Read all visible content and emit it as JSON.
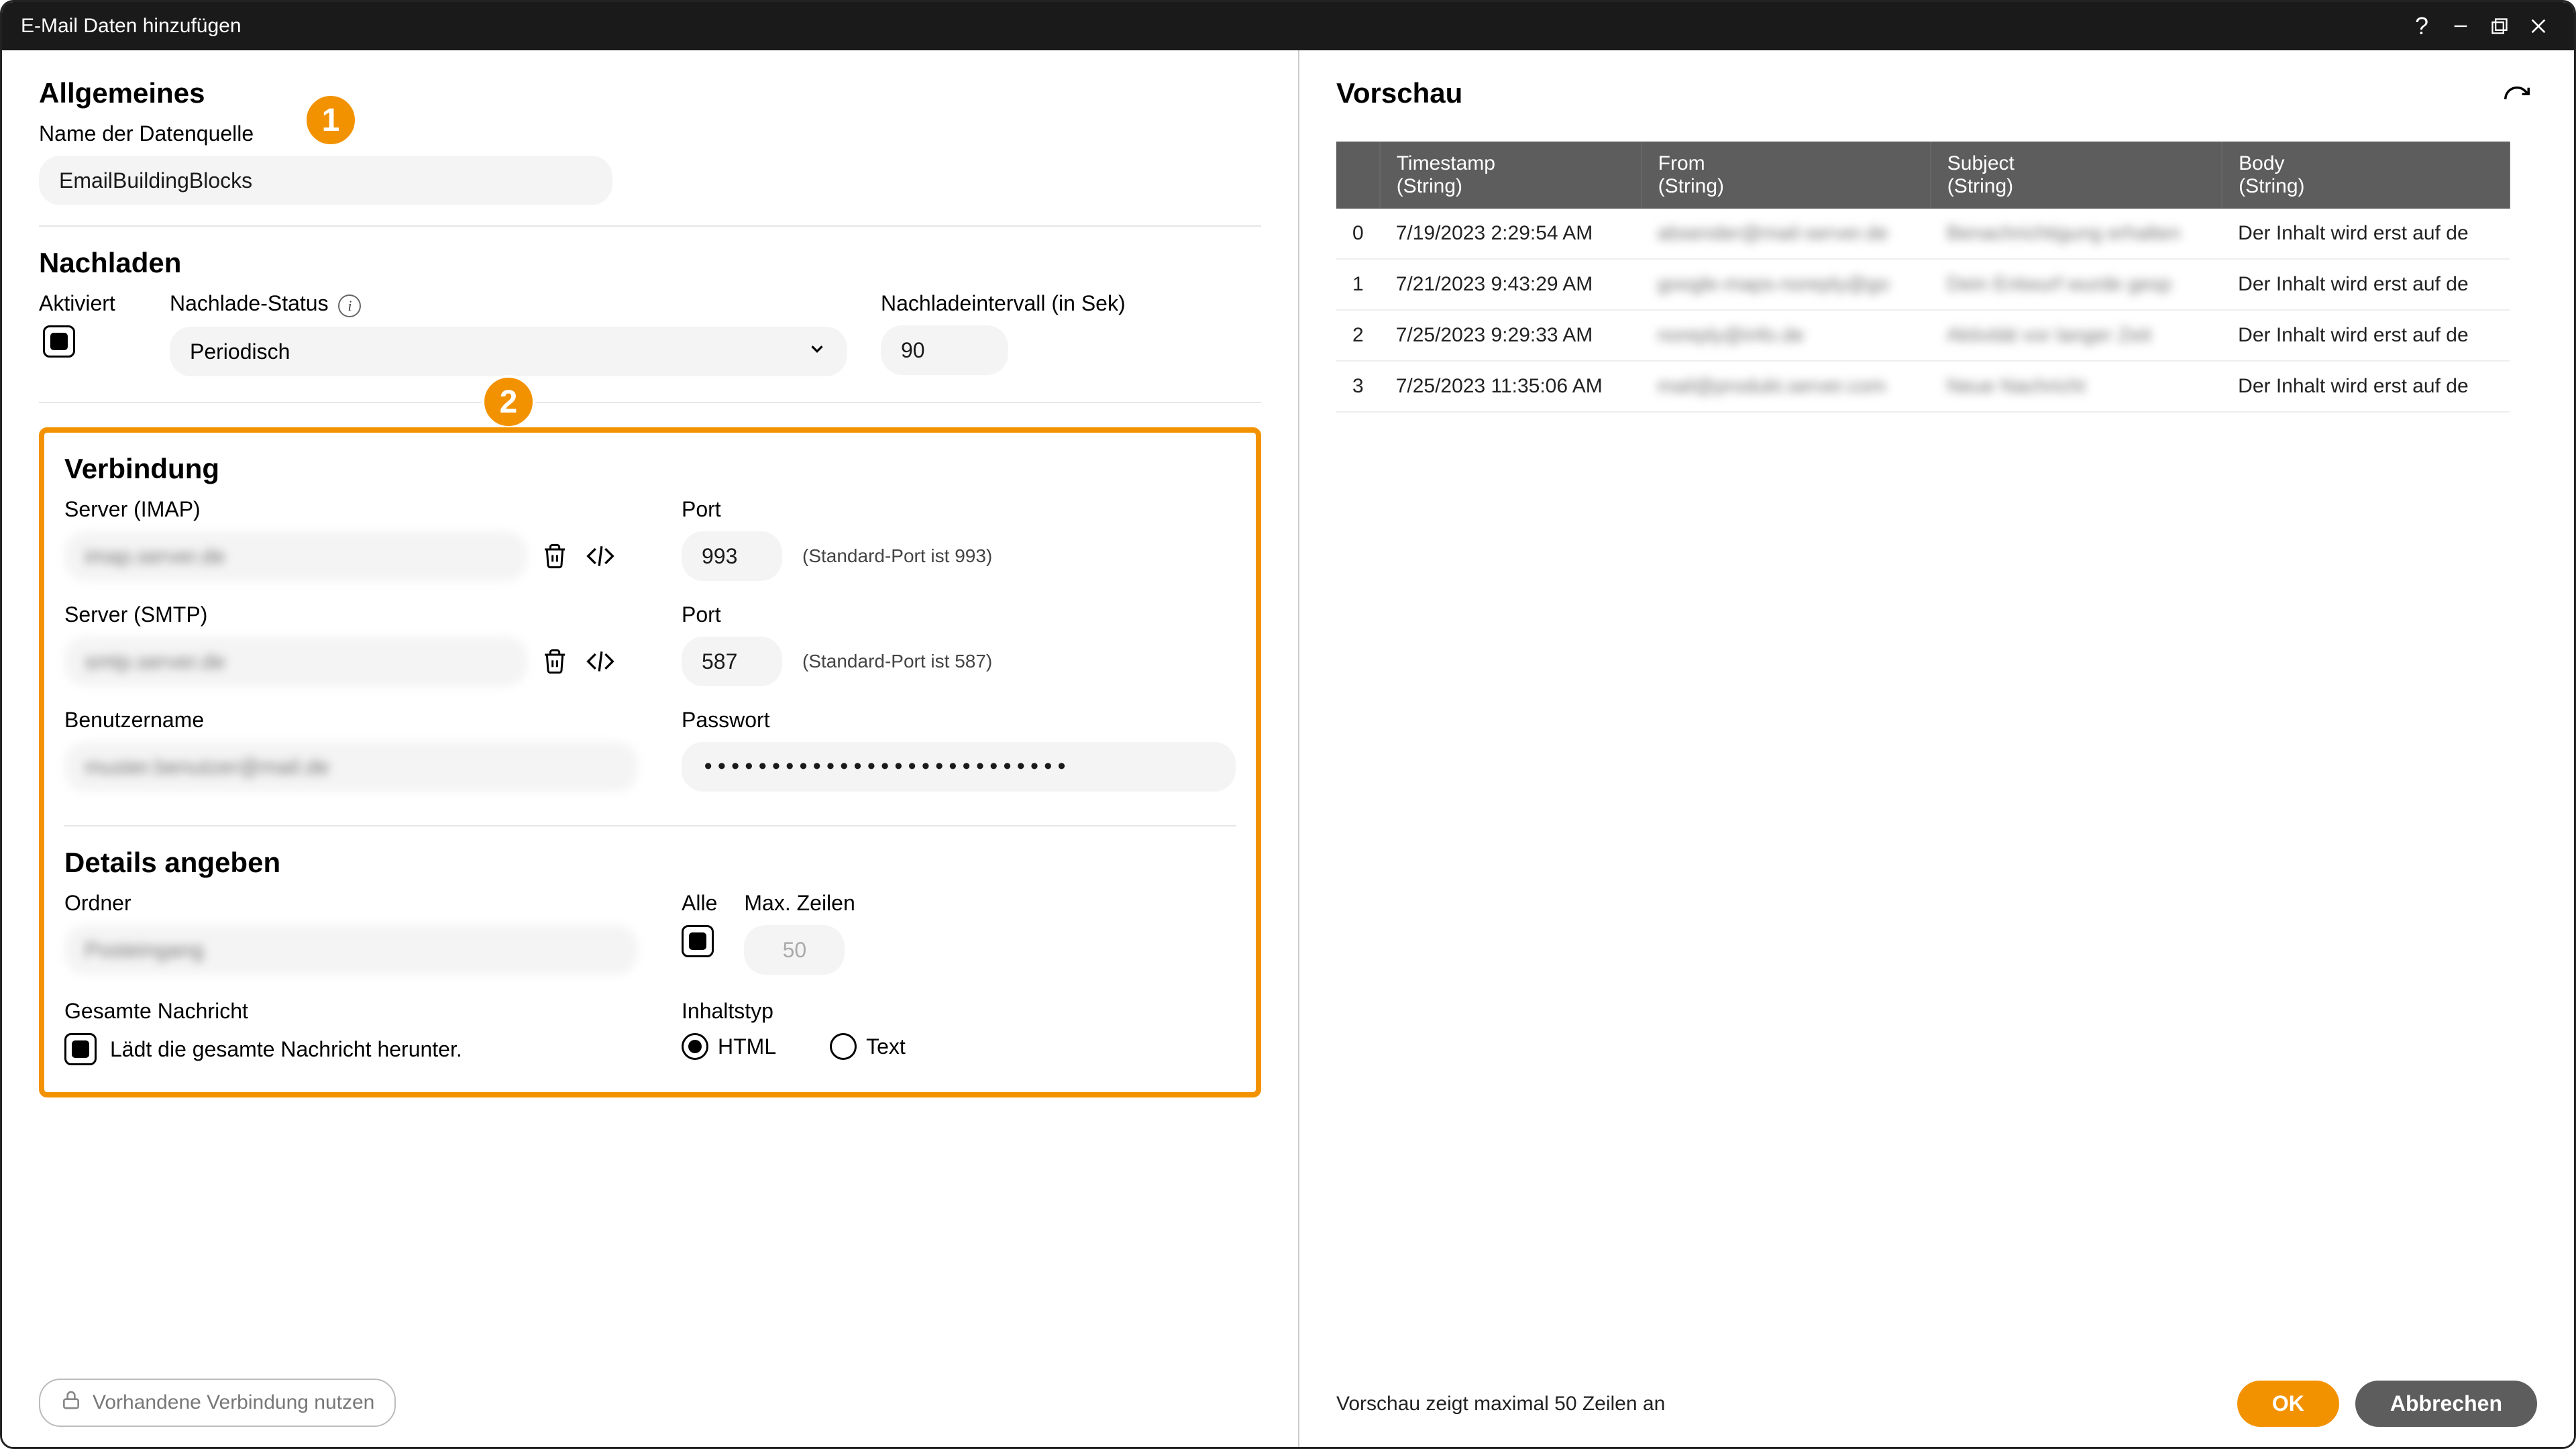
{
  "window": {
    "title": "E-Mail Daten hinzufügen"
  },
  "general": {
    "heading": "Allgemeines",
    "name_label": "Name der Datenquelle",
    "name_value": "EmailBuildingBlocks"
  },
  "reload": {
    "heading": "Nachladen",
    "enabled_label": "Aktiviert",
    "status_label": "Nachlade-Status",
    "status_value": "Periodisch",
    "interval_label": "Nachladeintervall (in Sek)",
    "interval_value": "90"
  },
  "connection": {
    "heading": "Verbindung",
    "imap_label": "Server (IMAP)",
    "imap_value": "imap.server.de",
    "imap_port_label": "Port",
    "imap_port_value": "993",
    "imap_hint": "(Standard-Port ist 993)",
    "smtp_label": "Server (SMTP)",
    "smtp_value": "smtp.server.de",
    "smtp_port_label": "Port",
    "smtp_port_value": "587",
    "smtp_hint": "(Standard-Port ist 587)",
    "user_label": "Benutzername",
    "user_value": "muster.benutzer@mail.de",
    "pass_label": "Passwort",
    "pass_value": "***************************"
  },
  "details": {
    "heading": "Details angeben",
    "folder_label": "Ordner",
    "folder_value": "Posteingang",
    "all_label": "Alle",
    "maxrows_label": "Max. Zeilen",
    "maxrows_value": "50",
    "fullmsg_label": "Gesamte Nachricht",
    "fullmsg_desc": "Lädt die gesamte Nachricht herunter.",
    "contenttype_label": "Inhaltstyp",
    "html_label": "HTML",
    "text_label": "Text"
  },
  "existing_conn": "Vorhandene Verbindung nutzen",
  "preview": {
    "heading": "Vorschau",
    "cols": [
      {
        "name": "Timestamp",
        "type": "(String)"
      },
      {
        "name": "From",
        "type": "(String)"
      },
      {
        "name": "Subject",
        "type": "(String)"
      },
      {
        "name": "Body",
        "type": "(String)"
      }
    ],
    "rows": [
      {
        "idx": "0",
        "ts": "7/19/2023 2:29:54 AM",
        "from": "absender@mail-server.de",
        "subject": "Benachrichtigung erhalten",
        "body": "Der Inhalt wird erst auf de"
      },
      {
        "idx": "1",
        "ts": "7/21/2023 9:43:29 AM",
        "from": "google-maps-noreply@go",
        "subject": "Dein Entwurf wurde gesp",
        "body": "Der Inhalt wird erst auf de"
      },
      {
        "idx": "2",
        "ts": "7/25/2023 9:29:33 AM",
        "from": "noreply@info.de",
        "subject": "Aktivität vor langer Zeit",
        "body": "Der Inhalt wird erst auf de"
      },
      {
        "idx": "3",
        "ts": "7/25/2023 11:35:06 AM",
        "from": "mail@produkt.server.com",
        "subject": "Neue Nachricht",
        "body": "Der Inhalt wird erst auf de"
      }
    ],
    "footer": "Vorschau zeigt maximal 50 Zeilen an"
  },
  "buttons": {
    "ok": "OK",
    "cancel": "Abbrechen"
  },
  "badges": {
    "one": "1",
    "two": "2"
  }
}
